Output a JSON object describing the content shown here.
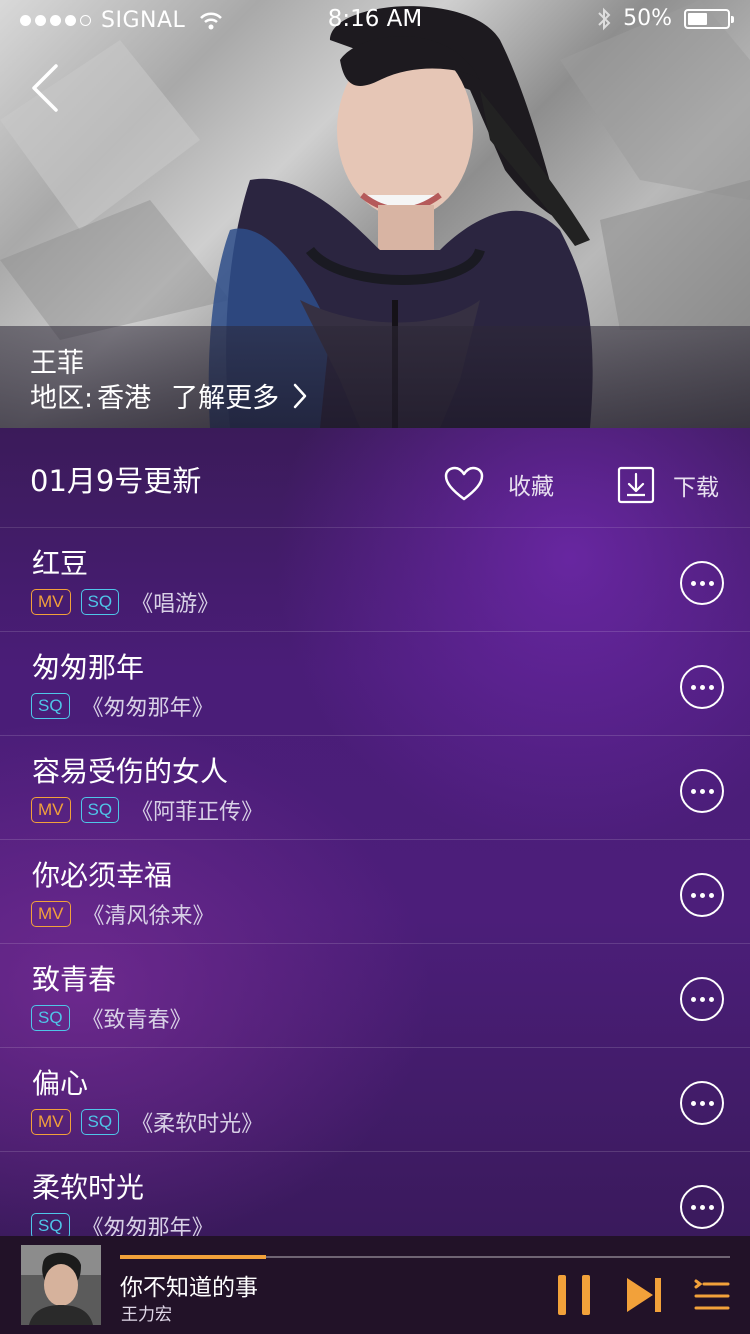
{
  "status_bar": {
    "carrier": "SIGNAL",
    "time": "8:16 AM",
    "battery_text": "50%",
    "battery_level": 0.5
  },
  "artist": {
    "name": "王菲",
    "region_label": "地区:",
    "region_value": "香港",
    "more_label": "了解更多"
  },
  "toolbar": {
    "update_title": "01月9号更新",
    "favorite_label": "收藏",
    "download_label": "下载"
  },
  "songs": [
    {
      "title": "红豆",
      "mv": true,
      "sq": true,
      "album": "《唱游》"
    },
    {
      "title": "匆匆那年",
      "mv": false,
      "sq": true,
      "album": "《匆匆那年》"
    },
    {
      "title": "容易受伤的女人",
      "mv": true,
      "sq": true,
      "album": "《阿菲正传》"
    },
    {
      "title": "你必须幸福",
      "mv": true,
      "sq": false,
      "album": "《清风徐来》"
    },
    {
      "title": "致青春",
      "mv": false,
      "sq": true,
      "album": "《致青春》"
    },
    {
      "title": "偏心",
      "mv": true,
      "sq": true,
      "album": "《柔软时光》"
    },
    {
      "title": "柔软时光",
      "mv": false,
      "sq": true,
      "album": "《匆匆那年》"
    }
  ],
  "tags": {
    "mv": "MV",
    "sq": "SQ"
  },
  "player": {
    "title": "你不知道的事",
    "artist": "王力宏",
    "progress": 0.24
  },
  "colors": {
    "accent_orange": "#f2a13a",
    "tag_blue": "#4fc6e8",
    "list_purple": "#4a1d78",
    "player_bg": "#221228"
  },
  "icons": {
    "back": "chevron-left-icon",
    "more_link": "chevron-right-icon",
    "favorite": "heart-icon",
    "download": "download-icon",
    "row_more": "more-dots-icon",
    "pause": "pause-icon",
    "next": "skip-next-icon",
    "playlist": "playlist-icon"
  }
}
